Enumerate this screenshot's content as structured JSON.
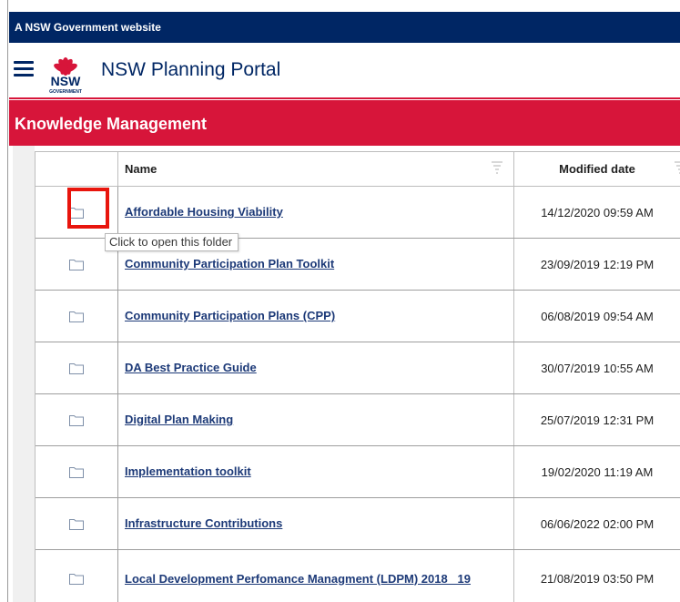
{
  "gov_banner": {
    "text": "A NSW Government website"
  },
  "header": {
    "menu_icon": "hamburger-menu-icon",
    "logo": {
      "icon": "waratah-logo-icon",
      "text": "NSW",
      "subtext": "GOVERNMENT"
    },
    "title": "NSW Planning Portal"
  },
  "section": {
    "title": "Knowledge Management"
  },
  "grid": {
    "columns": {
      "name": "Name",
      "modified": "Modified date"
    },
    "rows": [
      {
        "name": "Affordable Housing Viability",
        "modified": "14/12/2020 09:59 AM"
      },
      {
        "name": "Community Participation Plan Toolkit",
        "modified": "23/09/2019 12:19 PM"
      },
      {
        "name": "Community Participation Plans (CPP)",
        "modified": "06/08/2019 09:54 AM"
      },
      {
        "name": "DA Best Practice Guide",
        "modified": "30/07/2019 10:55 AM"
      },
      {
        "name": "Digital Plan Making",
        "modified": "25/07/2019 12:31 PM"
      },
      {
        "name": "Implementation toolkit",
        "modified": "19/02/2020 11:19 AM"
      },
      {
        "name": "Infrastructure Contributions",
        "modified": "06/06/2022 02:00 PM"
      },
      {
        "name": "Local Development Perfomance Managment (LDPM) 2018 _19",
        "modified": "21/08/2019 03:50 PM"
      }
    ]
  },
  "tooltip": {
    "text": "Click to open this folder"
  },
  "colors": {
    "gov_blue": "#002664",
    "nsw_red": "#d7153a",
    "link": "#1d3a78",
    "highlight": "#e8150d"
  }
}
